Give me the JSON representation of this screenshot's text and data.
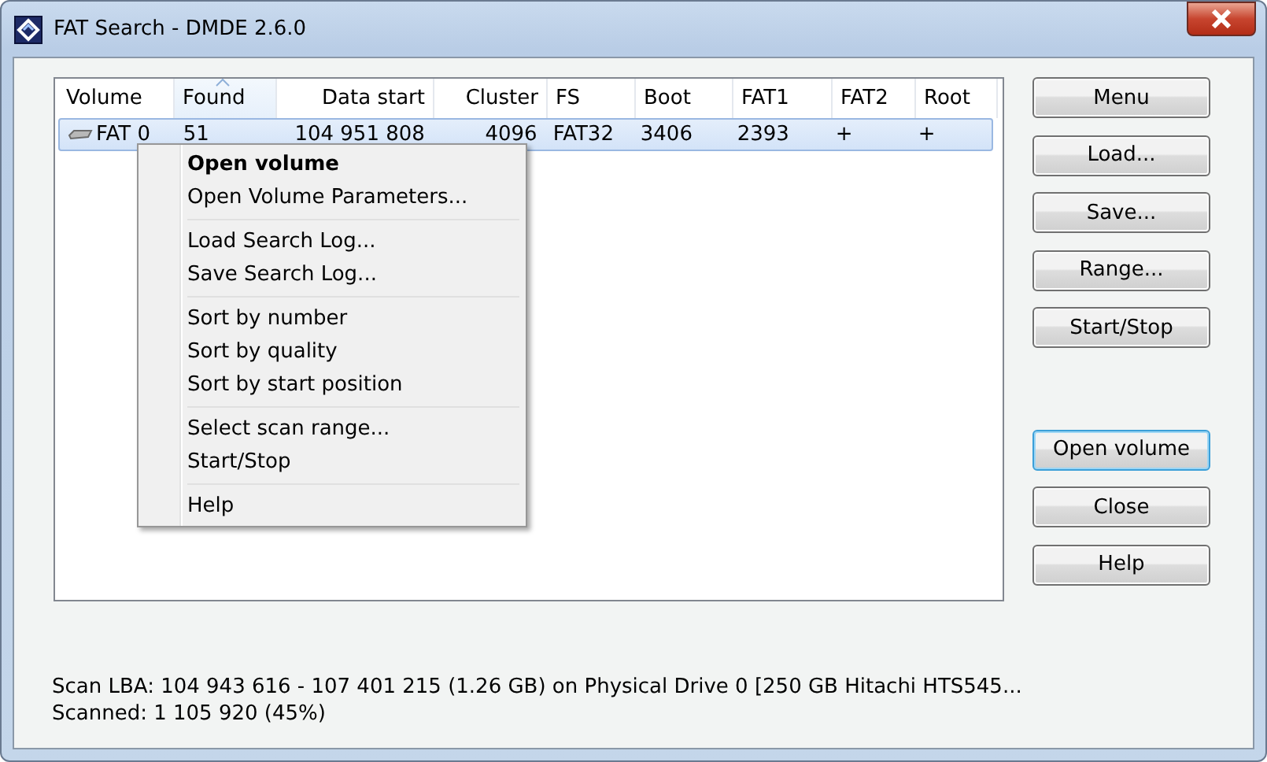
{
  "window": {
    "title": "FAT Search - DMDE 2.6.0"
  },
  "table": {
    "columns": [
      {
        "label": "Volume",
        "sorted": false
      },
      {
        "label": "Found",
        "sorted": true
      },
      {
        "label": "Data start",
        "sorted": false
      },
      {
        "label": "Cluster",
        "sorted": false
      },
      {
        "label": "FS",
        "sorted": false
      },
      {
        "label": "Boot",
        "sorted": false
      },
      {
        "label": "FAT1",
        "sorted": false
      },
      {
        "label": "FAT2",
        "sorted": false
      },
      {
        "label": "Root",
        "sorted": false
      }
    ],
    "rows": [
      {
        "selected": true,
        "cells": [
          "FAT 0",
          "51",
          "104 951 808",
          "4096",
          "FAT32",
          "3406",
          "2393",
          "+",
          "+"
        ]
      }
    ]
  },
  "context_menu": [
    {
      "kind": "item",
      "label": "Open volume",
      "default": true
    },
    {
      "kind": "item",
      "label": "Open Volume Parameters...",
      "default": false
    },
    {
      "kind": "separator"
    },
    {
      "kind": "item",
      "label": "Load Search Log...",
      "default": false
    },
    {
      "kind": "item",
      "label": "Save Search Log...",
      "default": false
    },
    {
      "kind": "separator"
    },
    {
      "kind": "item",
      "label": "Sort by number",
      "default": false
    },
    {
      "kind": "item",
      "label": "Sort by quality",
      "default": false
    },
    {
      "kind": "item",
      "label": "Sort by start position",
      "default": false
    },
    {
      "kind": "separator"
    },
    {
      "kind": "item",
      "label": "Select scan range...",
      "default": false
    },
    {
      "kind": "item",
      "label": "Start/Stop",
      "default": false
    },
    {
      "kind": "separator"
    },
    {
      "kind": "item",
      "label": "Help",
      "default": false
    }
  ],
  "buttons_top": [
    {
      "label": "Menu",
      "default": false
    },
    {
      "label": "Load...",
      "default": false
    },
    {
      "label": "Save...",
      "default": false
    },
    {
      "label": "Range...",
      "default": false
    },
    {
      "label": "Start/Stop",
      "default": false
    }
  ],
  "buttons_bottom": [
    {
      "label": "Open volume",
      "default": true
    },
    {
      "label": "Close",
      "default": false
    },
    {
      "label": "Help",
      "default": false
    }
  ],
  "status": [
    "Scan LBA: 104 943 616 - 107 401 215 (1.26 GB) on Physical Drive 0 [250 GB Hitachi HTS545...",
    "Scanned: 1 105 920 (45%)"
  ]
}
